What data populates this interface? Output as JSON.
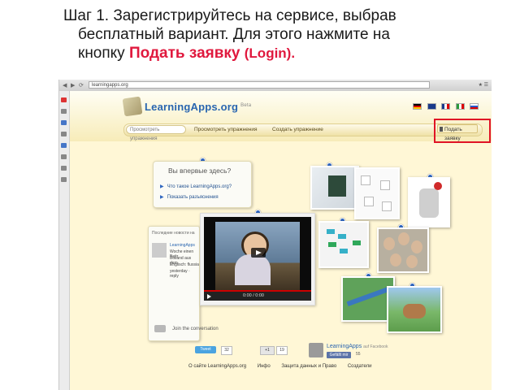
{
  "heading": {
    "line1": "Шаг 1. Зарегистрируйтесь на сервисе, выбрав",
    "line2": "бесплатный вариант. Для этого нажмите на",
    "line3_prefix": "кнопку ",
    "button_name": "Подать заявку",
    "button_en": "(Login)."
  },
  "browser": {
    "url": "learningapps.org"
  },
  "site": {
    "logo": "LearningApps.org",
    "beta": "Beta",
    "search_placeholder": "Просмотреть упражнения",
    "tabs": [
      "Просмотреть упражнения",
      "Создать упражнение"
    ],
    "login_button": "Подать заявку",
    "first_time": {
      "question": "Вы впервые здесь?",
      "links": [
        "Что такое LearningApps.org?",
        "Показать разъяснения"
      ]
    },
    "news": {
      "title": "Последние новости на",
      "lines": [
        "LearningApps",
        "Woche einen Beitr",
        "Boiland aus dem",
        "Englisch: flussia",
        "yesterday · reply"
      ]
    },
    "video": {
      "time": "0:00 / 0:00"
    },
    "join": "Join the conversation",
    "social": {
      "tweet": "Tweet",
      "tweet_count": "32",
      "gplus": "+1",
      "gplus_count": "19",
      "fb_name": "LearningApps",
      "fb_sub": "auf Facebook",
      "fb_like": "Gefällt mir",
      "fb_count": "55"
    },
    "footer": [
      "О сайте LearningApps.org",
      "Инфо",
      "Защита данных и Право",
      "Создатели"
    ]
  },
  "colors": {
    "highlight": "#e01426",
    "accent_red": "#e0193e",
    "link_blue": "#2a66b0"
  }
}
